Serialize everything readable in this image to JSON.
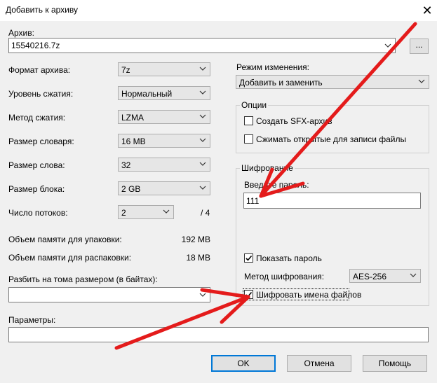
{
  "window": {
    "title": "Добавить к архиву",
    "close_glyph": "✕"
  },
  "archive": {
    "label": "Архив:",
    "value": "15540216.7z",
    "browse_label": "..."
  },
  "left": {
    "format": {
      "label": "Формат архива:",
      "value": "7z"
    },
    "level": {
      "label": "Уровень сжатия:",
      "value": "Нормальный"
    },
    "method": {
      "label": "Метод сжатия:",
      "value": "LZMA"
    },
    "dict": {
      "label": "Размер словаря:",
      "value": "16 MB"
    },
    "word": {
      "label": "Размер слова:",
      "value": "32"
    },
    "block": {
      "label": "Размер блока:",
      "value": "2 GB"
    },
    "threads": {
      "label": "Число потоков:",
      "value": "2",
      "total": "/ 4"
    },
    "mem_pack": {
      "label": "Объем памяти для упаковки:",
      "value": "192 MB"
    },
    "mem_unpack": {
      "label": "Объем памяти для распаковки:",
      "value": "18 MB"
    },
    "split": {
      "label": "Разбить на тома размером (в байтах):",
      "value": ""
    },
    "params": {
      "label": "Параметры:",
      "value": ""
    }
  },
  "right": {
    "update_mode": {
      "label": "Режим изменения:",
      "value": "Добавить и заменить"
    },
    "options": {
      "title": "Опции",
      "sfx": {
        "label": "Создать SFX-архив",
        "checked": false
      },
      "shared": {
        "label": "Сжимать открытые для записи файлы",
        "checked": false
      }
    },
    "encryption": {
      "title": "Шифрование",
      "password_label": "Введите пароль:",
      "password_value": "111",
      "show_password": {
        "label": "Показать пароль",
        "checked": true
      },
      "method_label": "Метод шифрования:",
      "method_value": "AES-256",
      "encrypt_names": {
        "label": "Шифровать имена файлов",
        "checked": true
      }
    }
  },
  "buttons": {
    "ok": "OK",
    "cancel": "Отмена",
    "help": "Помощь"
  },
  "colors": {
    "arrow": "#e41b1b",
    "focus": "#0078d7"
  }
}
